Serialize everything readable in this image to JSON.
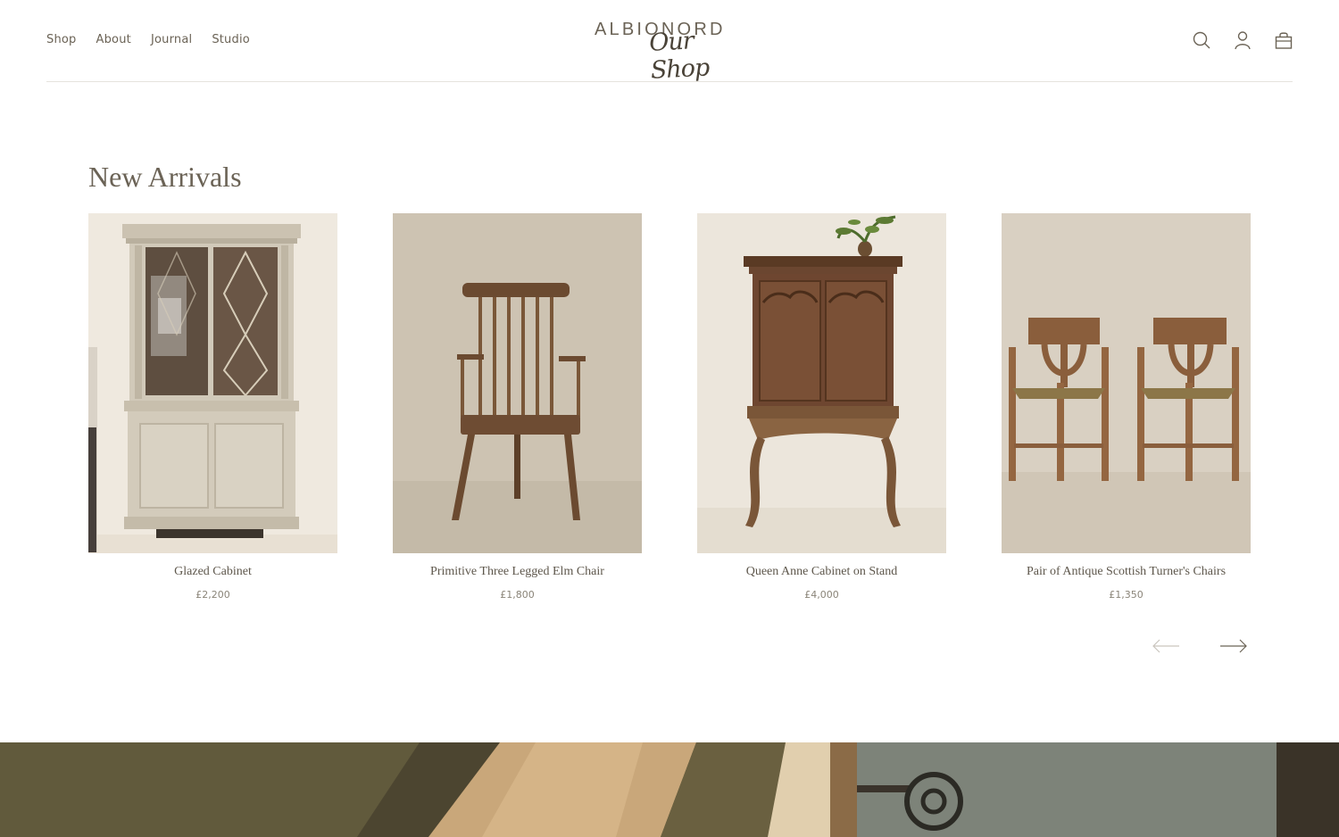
{
  "header": {
    "nav": [
      "Shop",
      "About",
      "Journal",
      "Studio"
    ],
    "logo_word": "ALBIONORD",
    "logo_script": "Our Shop",
    "icons": [
      "search-icon",
      "account-icon",
      "bag-icon"
    ]
  },
  "section": {
    "title": "New Arrivals"
  },
  "products": [
    {
      "name": "Glazed Cabinet",
      "price": "£2,200"
    },
    {
      "name": "Primitive Three Legged Elm Chair",
      "price": "£1,800"
    },
    {
      "name": "Queen Anne Cabinet on Stand",
      "price": "£4,000"
    },
    {
      "name": "Pair of Antique Scottish Turner's Chairs",
      "price": "£1,350"
    }
  ],
  "carousel": {
    "prev_icon": "arrow-left-icon",
    "next_icon": "arrow-right-icon"
  },
  "colors": {
    "text": "#6b6356",
    "photo_bg_1": "#efe9df",
    "photo_bg_2": "#cdc3b2",
    "photo_bg_3": "#ece6dc",
    "photo_bg_4": "#d9d0c2"
  }
}
